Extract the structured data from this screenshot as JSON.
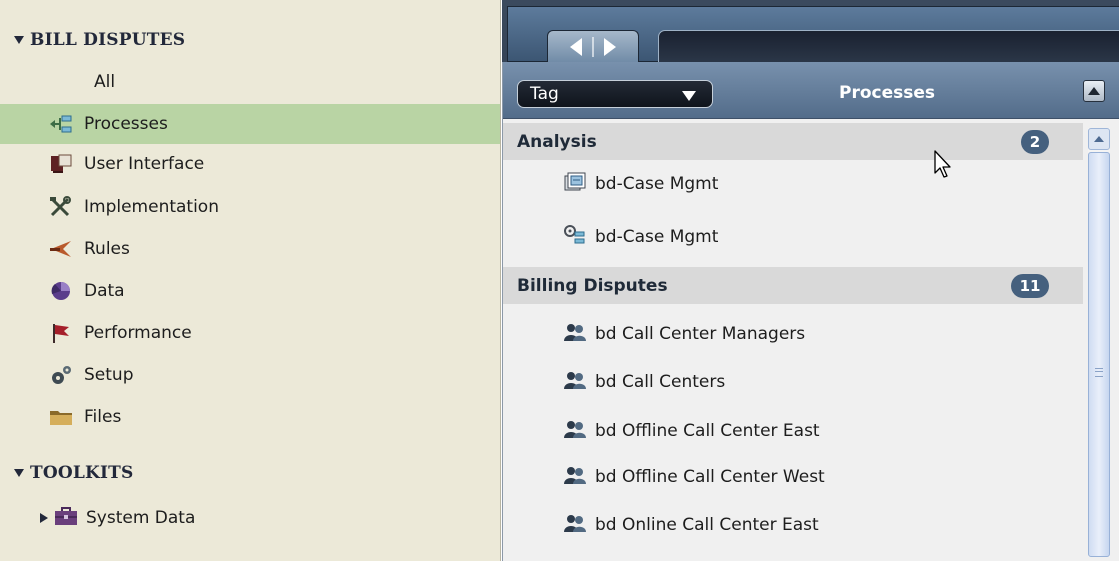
{
  "sidebar": {
    "bill_disputes": {
      "header": "BILL DISPUTES",
      "items": [
        {
          "label": "All",
          "icon": "none"
        },
        {
          "label": "Processes",
          "icon": "process-icon",
          "selected": true
        },
        {
          "label": "User Interface",
          "icon": "user-interface-icon"
        },
        {
          "label": "Implementation",
          "icon": "tools-icon"
        },
        {
          "label": "Rules",
          "icon": "rules-icon"
        },
        {
          "label": "Data",
          "icon": "data-icon"
        },
        {
          "label": "Performance",
          "icon": "flag-icon"
        },
        {
          "label": "Setup",
          "icon": "gears-icon"
        },
        {
          "label": "Files",
          "icon": "folder-icon"
        }
      ]
    },
    "toolkits": {
      "header": "TOOLKITS",
      "items": [
        {
          "label": "System Data",
          "icon": "briefcase-icon"
        }
      ]
    }
  },
  "panel": {
    "tag_select": {
      "value": "Tag"
    },
    "title": "Processes",
    "groups": [
      {
        "name": "Analysis",
        "count": "2",
        "items": [
          {
            "label": "bd-Case Mgmt",
            "icon": "process-model-icon"
          },
          {
            "label": "bd-Case Mgmt",
            "icon": "process-config-icon"
          }
        ]
      },
      {
        "name": "Billing Disputes",
        "count": "11",
        "items": [
          {
            "label": "bd Call Center Managers",
            "icon": "group-icon"
          },
          {
            "label": "bd Call Centers",
            "icon": "group-icon"
          },
          {
            "label": "bd Offline Call Center East",
            "icon": "group-icon"
          },
          {
            "label": "bd Offline Call Center West",
            "icon": "group-icon"
          },
          {
            "label": "bd Online Call Center East",
            "icon": "group-icon"
          }
        ]
      }
    ]
  },
  "colors": {
    "sidebar_bg": "#ece9d8",
    "selected_bg": "#b9d4a4",
    "group_row_bg": "#d9d9d9",
    "badge_bg": "#45607e",
    "panel_head": "#607a98"
  }
}
